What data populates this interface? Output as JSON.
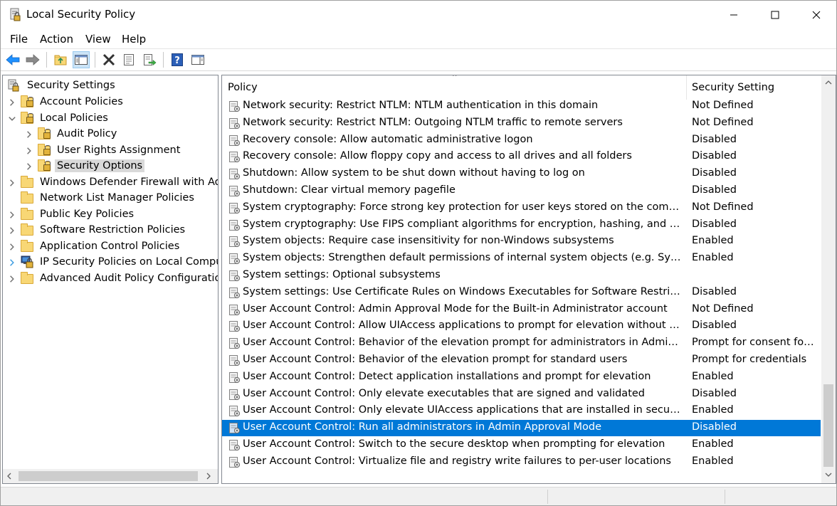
{
  "window": {
    "title": "Local Security Policy"
  },
  "menu": [
    "File",
    "Action",
    "View",
    "Help"
  ],
  "toolbar": {
    "buttons": [
      "back-icon",
      "forward-icon",
      "up-folder-icon",
      "show-hide-console-tree-icon",
      "delete-icon",
      "properties-icon",
      "export-list-icon",
      "help-icon",
      "show-action-pane-icon"
    ]
  },
  "tree": {
    "root": "Security Settings",
    "items": [
      {
        "label": "Account Policies",
        "level": 1,
        "expander": "collapsed",
        "icon": "folder-lock"
      },
      {
        "label": "Local Policies",
        "level": 1,
        "expander": "expanded",
        "icon": "folder-lock"
      },
      {
        "label": "Audit Policy",
        "level": 2,
        "expander": "collapsed",
        "icon": "folder-lock"
      },
      {
        "label": "User Rights Assignment",
        "level": 2,
        "expander": "collapsed",
        "icon": "folder-lock"
      },
      {
        "label": "Security Options",
        "level": 2,
        "expander": "collapsed",
        "icon": "folder-lock",
        "selected": true
      },
      {
        "label": "Windows Defender Firewall with Advan",
        "level": 1,
        "expander": "collapsed",
        "icon": "folder"
      },
      {
        "label": "Network List Manager Policies",
        "level": 1,
        "expander": "none",
        "icon": "folder"
      },
      {
        "label": "Public Key Policies",
        "level": 1,
        "expander": "collapsed",
        "icon": "folder"
      },
      {
        "label": "Software Restriction Policies",
        "level": 1,
        "expander": "collapsed",
        "icon": "folder"
      },
      {
        "label": "Application Control Policies",
        "level": 1,
        "expander": "collapsed",
        "icon": "folder"
      },
      {
        "label": "IP Security Policies on Local Computer",
        "level": 1,
        "expander": "collapsed",
        "icon": "ip-security"
      },
      {
        "label": "Advanced Audit Policy Configuration",
        "level": 1,
        "expander": "collapsed",
        "icon": "folder"
      }
    ]
  },
  "list": {
    "columns": [
      "Policy",
      "Security Setting"
    ],
    "rows": [
      {
        "policy": "Network security: Restrict NTLM: NTLM authentication in this domain",
        "setting": "Not Defined"
      },
      {
        "policy": "Network security: Restrict NTLM: Outgoing NTLM traffic to remote servers",
        "setting": "Not Defined"
      },
      {
        "policy": "Recovery console: Allow automatic administrative logon",
        "setting": "Disabled"
      },
      {
        "policy": "Recovery console: Allow floppy copy and access to all drives and all folders",
        "setting": "Disabled"
      },
      {
        "policy": "Shutdown: Allow system to be shut down without having to log on",
        "setting": "Disabled"
      },
      {
        "policy": "Shutdown: Clear virtual memory pagefile",
        "setting": "Disabled"
      },
      {
        "policy": "System cryptography: Force strong key protection for user keys stored on the computer",
        "setting": "Not Defined"
      },
      {
        "policy": "System cryptography: Use FIPS compliant algorithms for encryption, hashing, and signing",
        "setting": "Disabled"
      },
      {
        "policy": "System objects: Require case insensitivity for non-Windows subsystems",
        "setting": "Enabled"
      },
      {
        "policy": "System objects: Strengthen default permissions of internal system objects (e.g. Symbolic Links)",
        "setting": "Enabled"
      },
      {
        "policy": "System settings: Optional subsystems",
        "setting": ""
      },
      {
        "policy": "System settings: Use Certificate Rules on Windows Executables for Software Restriction Policies",
        "setting": "Disabled"
      },
      {
        "policy": "User Account Control: Admin Approval Mode for the Built-in Administrator account",
        "setting": "Not Defined"
      },
      {
        "policy": "User Account Control: Allow UIAccess applications to prompt for elevation without using the s...",
        "setting": "Disabled"
      },
      {
        "policy": "User Account Control: Behavior of the elevation prompt for administrators in Admin Approval ...",
        "setting": "Prompt for consent for n..."
      },
      {
        "policy": "User Account Control: Behavior of the elevation prompt for standard users",
        "setting": "Prompt for credentials"
      },
      {
        "policy": "User Account Control: Detect application installations and prompt for elevation",
        "setting": "Enabled"
      },
      {
        "policy": "User Account Control: Only elevate executables that are signed and validated",
        "setting": "Disabled"
      },
      {
        "policy": "User Account Control: Only elevate UIAccess applications that are installed in secure locations",
        "setting": "Enabled"
      },
      {
        "policy": "User Account Control: Run all administrators in Admin Approval Mode",
        "setting": "Disabled",
        "selected": true
      },
      {
        "policy": "User Account Control: Switch to the secure desktop when prompting for elevation",
        "setting": "Enabled"
      },
      {
        "policy": "User Account Control: Virtualize file and registry write failures to per-user locations",
        "setting": "Enabled"
      }
    ]
  },
  "colors": {
    "selection": "#0078d7",
    "tree_selection": "#d9d9d9",
    "accent": "#1e90ff"
  }
}
